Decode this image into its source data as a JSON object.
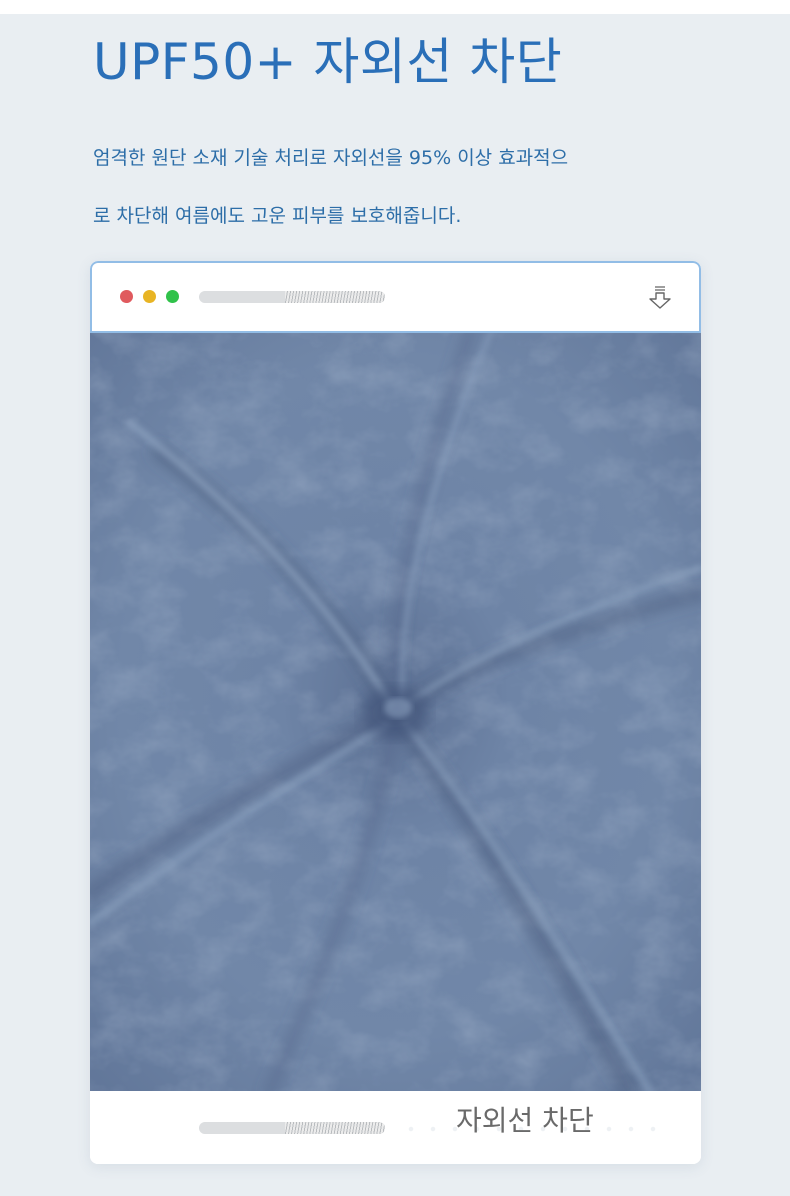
{
  "header": {
    "title": "UPF50+ 자외선 차단",
    "description_line1": "엄격한 원단 소재 기술 처리로 자외선을 95% 이상 효과적으",
    "description_line2": "로 차단해 여름에도 고운 피부를 보호해줍니다."
  },
  "browser": {
    "window_controls": [
      "close",
      "minimize",
      "maximize"
    ],
    "toolbar_icon": "download-icon",
    "image": "crumpled blue-gray fabric swirl"
  },
  "footer": {
    "caption": "자외선 차단"
  },
  "colors": {
    "accent": "#2a6fb8",
    "background": "#e9eef2",
    "fabric": "#6f86a8",
    "frame_border": "#92bde6"
  }
}
